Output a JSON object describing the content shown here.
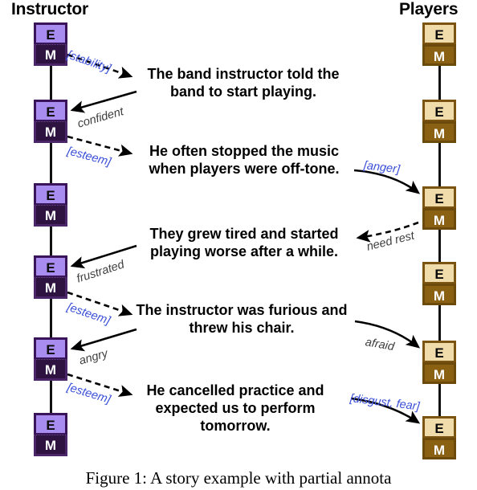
{
  "figure": {
    "caption": "Figure 1:   A story example with partial annota",
    "headers": {
      "left": "Instructor",
      "right": "Players"
    },
    "node_labels": {
      "appraisal": "E",
      "emotion": "M"
    },
    "colors": {
      "instructor_e_bg": "#a98cef",
      "instructor_m_bg": "#2e1341",
      "players_e_bg": "#f0dcab",
      "players_m_bg": "#8a6012",
      "appraisal_label": "#3a4fd8",
      "emotion_label": "#3d3d3d",
      "arrow": "#000000"
    }
  },
  "sentences": [
    {
      "id": "s1",
      "text": "The band instructor told the band to start playing."
    },
    {
      "id": "s2",
      "text": "He often stopped the music when players were off-tone."
    },
    {
      "id": "s3",
      "text": "They grew tired and started playing worse after a while."
    },
    {
      "id": "s4",
      "text": "The instructor was furious and threw his chair."
    },
    {
      "id": "s5",
      "text": "He cancelled practice and expected us to perform tomorrow."
    }
  ],
  "left_nodes": [
    {
      "e": "E",
      "m": "M"
    },
    {
      "e": "E",
      "m": "M"
    },
    {
      "e": "E",
      "m": "M"
    },
    {
      "e": "E",
      "m": "M"
    },
    {
      "e": "E",
      "m": "M"
    },
    {
      "e": "E",
      "m": "M"
    }
  ],
  "right_nodes": [
    {
      "e": "E",
      "m": "M"
    },
    {
      "e": "E",
      "m": "M"
    },
    {
      "e": "E",
      "m": "M"
    },
    {
      "e": "E",
      "m": "M"
    },
    {
      "e": "E",
      "m": "M"
    },
    {
      "e": "E",
      "m": "M"
    }
  ],
  "arrow_labels": {
    "a1": "[stability]",
    "a2": "confident",
    "a3": "[esteem]",
    "a4": "[anger]",
    "a5": "need rest",
    "a6": "frustrated",
    "a7": "[esteem]",
    "a8": "afraid",
    "a9": "angry",
    "a10": "[esteem]",
    "a11": "[disgust, fear]"
  }
}
